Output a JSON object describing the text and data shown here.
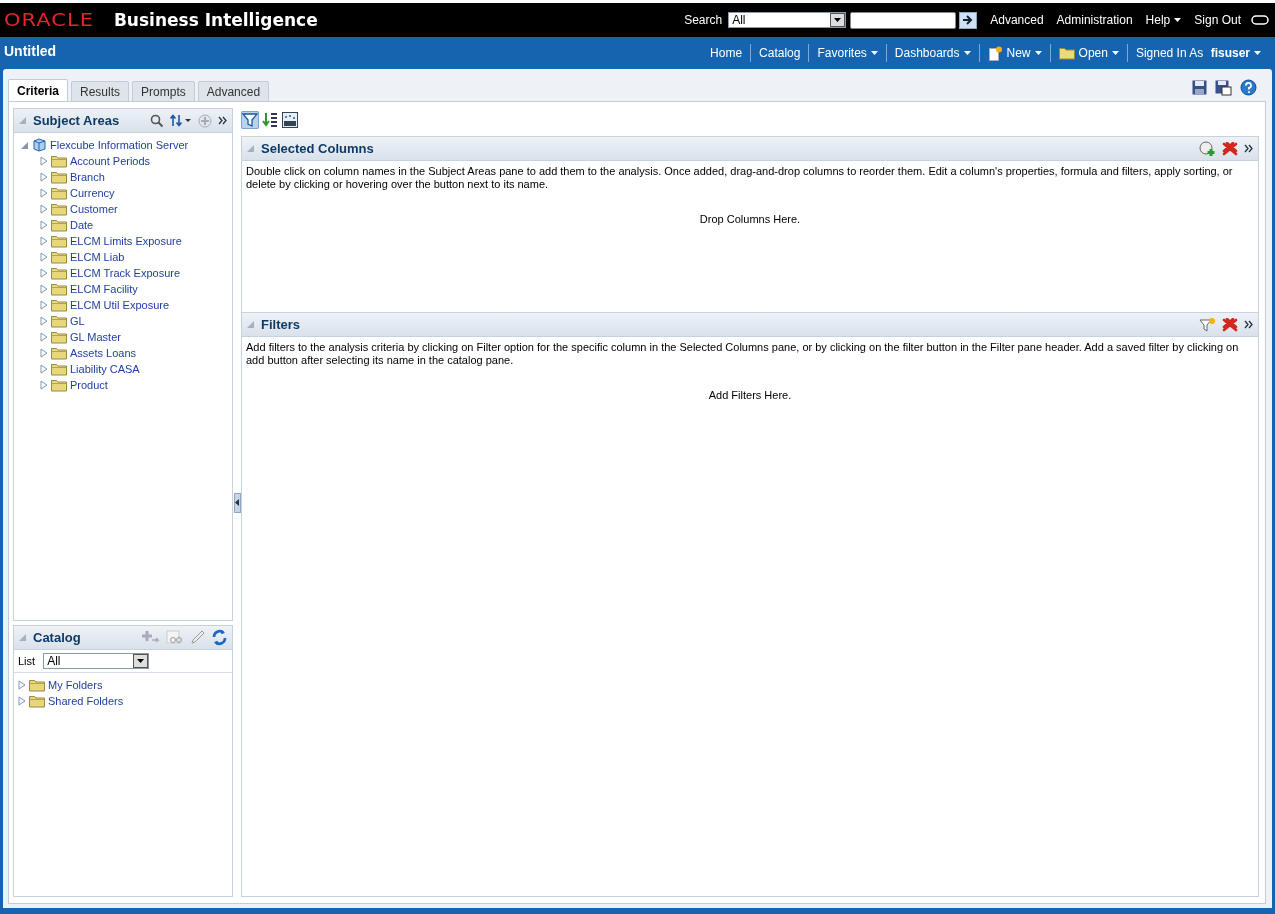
{
  "header": {
    "logo": "ORACLE",
    "product": "Business Intelligence",
    "search_label": "Search",
    "search_scope": "All",
    "links": [
      {
        "label": "Advanced",
        "menu": false
      },
      {
        "label": "Administration",
        "menu": false
      },
      {
        "label": "Help",
        "menu": true
      },
      {
        "label": "Sign Out",
        "menu": false
      }
    ]
  },
  "title": "Untitled",
  "nav": [
    {
      "label": "Home",
      "kind": "plain",
      "menu": false
    },
    {
      "label": "Catalog",
      "kind": "plain",
      "menu": false
    },
    {
      "label": "Favorites",
      "kind": "plain",
      "menu": true
    },
    {
      "label": "Dashboards",
      "kind": "plain",
      "menu": true
    },
    {
      "label": "New",
      "kind": "new",
      "menu": true
    },
    {
      "label": "Open",
      "kind": "open",
      "menu": true
    }
  ],
  "signed_in": {
    "label": "Signed In As",
    "user": "fisuser"
  },
  "tabs": [
    {
      "label": "Criteria",
      "selected": true
    },
    {
      "label": "Results",
      "selected": false
    },
    {
      "label": "Prompts",
      "selected": false
    },
    {
      "label": "Advanced",
      "selected": false
    }
  ],
  "subject_areas": {
    "title": "Subject Areas",
    "root": {
      "label": "Flexcube Information Server",
      "expanded": true,
      "children": [
        {
          "label": "Account Periods",
          "expanded": false
        },
        {
          "label": "Branch",
          "expanded": false
        },
        {
          "label": "Currency",
          "expanded": false
        },
        {
          "label": "Customer",
          "expanded": false
        },
        {
          "label": "Date",
          "expanded": false
        },
        {
          "label": "ELCM Limits Exposure",
          "expanded": false
        },
        {
          "label": "ELCM Liab",
          "expanded": false
        },
        {
          "label": "ELCM Track Exposure",
          "expanded": false
        },
        {
          "label": "ELCM Facility",
          "expanded": false
        },
        {
          "label": "ELCM Util Exposure",
          "expanded": false
        },
        {
          "label": "GL",
          "expanded": false
        },
        {
          "label": "GL Master",
          "expanded": false
        },
        {
          "label": "Assets Loans",
          "expanded": false
        },
        {
          "label": "Liability CASA",
          "expanded": false
        },
        {
          "label": "Product",
          "expanded": false
        }
      ]
    }
  },
  "catalog": {
    "title": "Catalog",
    "list_label": "List",
    "list_value": "All",
    "folders": [
      {
        "label": "My Folders",
        "expanded": false
      },
      {
        "label": "Shared Folders",
        "expanded": false
      }
    ]
  },
  "toolbar": [
    {
      "kind": "filter",
      "selected": true
    },
    {
      "kind": "sort",
      "selected": false
    },
    {
      "kind": "xyz",
      "selected": false
    }
  ],
  "selected_columns": {
    "title": "Selected Columns",
    "description": "Double click on column names in the Subject Areas pane to add them to the analysis. Once added, drag-and-drop columns to reorder them. Edit a column's properties, formula and filters, apply sorting, or delete by clicking or hovering over the button next to its name.",
    "empty_text": "Drop Columns Here."
  },
  "filters": {
    "title": "Filters",
    "description": "Add filters to the analysis criteria by clicking on Filter option for the specific column in the Selected Columns pane, or by clicking on the filter button in the Filter pane header. Add a saved filter by clicking on add button after selecting its name in the catalog pane.",
    "empty_text": "Add Filters Here."
  }
}
